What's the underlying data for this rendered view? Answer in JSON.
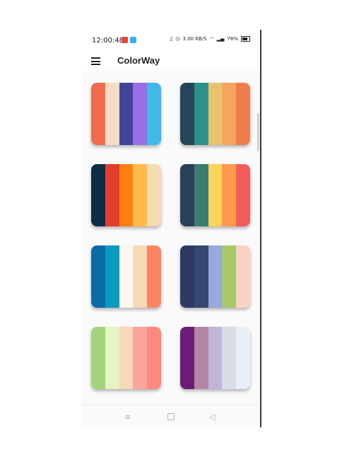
{
  "status_bar": {
    "time": "12:00:48",
    "net_speed": "3.00 KB/S",
    "battery": "78%"
  },
  "app_bar": {
    "title": "ColorWay"
  },
  "palettes": [
    {
      "colors": [
        "#f26b4f",
        "#f3dcc8",
        "#3f4598",
        "#9a6ce6",
        "#41b9e8"
      ]
    },
    {
      "colors": [
        "#254558",
        "#2a9389",
        "#e8c36f",
        "#f4a55e",
        "#ef7d4b"
      ]
    },
    {
      "colors": [
        "#0e2e48",
        "#e13f2b",
        "#ff7f11",
        "#ffba4c",
        "#f2dcb0"
      ]
    },
    {
      "colors": [
        "#2a3f5a",
        "#3b7d6f",
        "#fad55a",
        "#ff9a4f",
        "#f15d5d"
      ]
    },
    {
      "colors": [
        "#0b6ba5",
        "#0a9cbe",
        "#fbf7ec",
        "#f8d9b6",
        "#fb8463"
      ]
    },
    {
      "colors": [
        "#2d3b63",
        "#35476f",
        "#97a9dd",
        "#a6c86b",
        "#fbd2c1"
      ]
    },
    {
      "colors": [
        "#a2d47a",
        "#e6f3c2",
        "#f8d8b8",
        "#f9a49c",
        "#fa8a7e"
      ]
    },
    {
      "colors": [
        "#6b1c76",
        "#b386a3",
        "#c1b5d8",
        "#d9dde7",
        "#e8eff7"
      ]
    }
  ],
  "nav_bar": {
    "menu_glyph": "≡",
    "back_glyph": "◁"
  }
}
